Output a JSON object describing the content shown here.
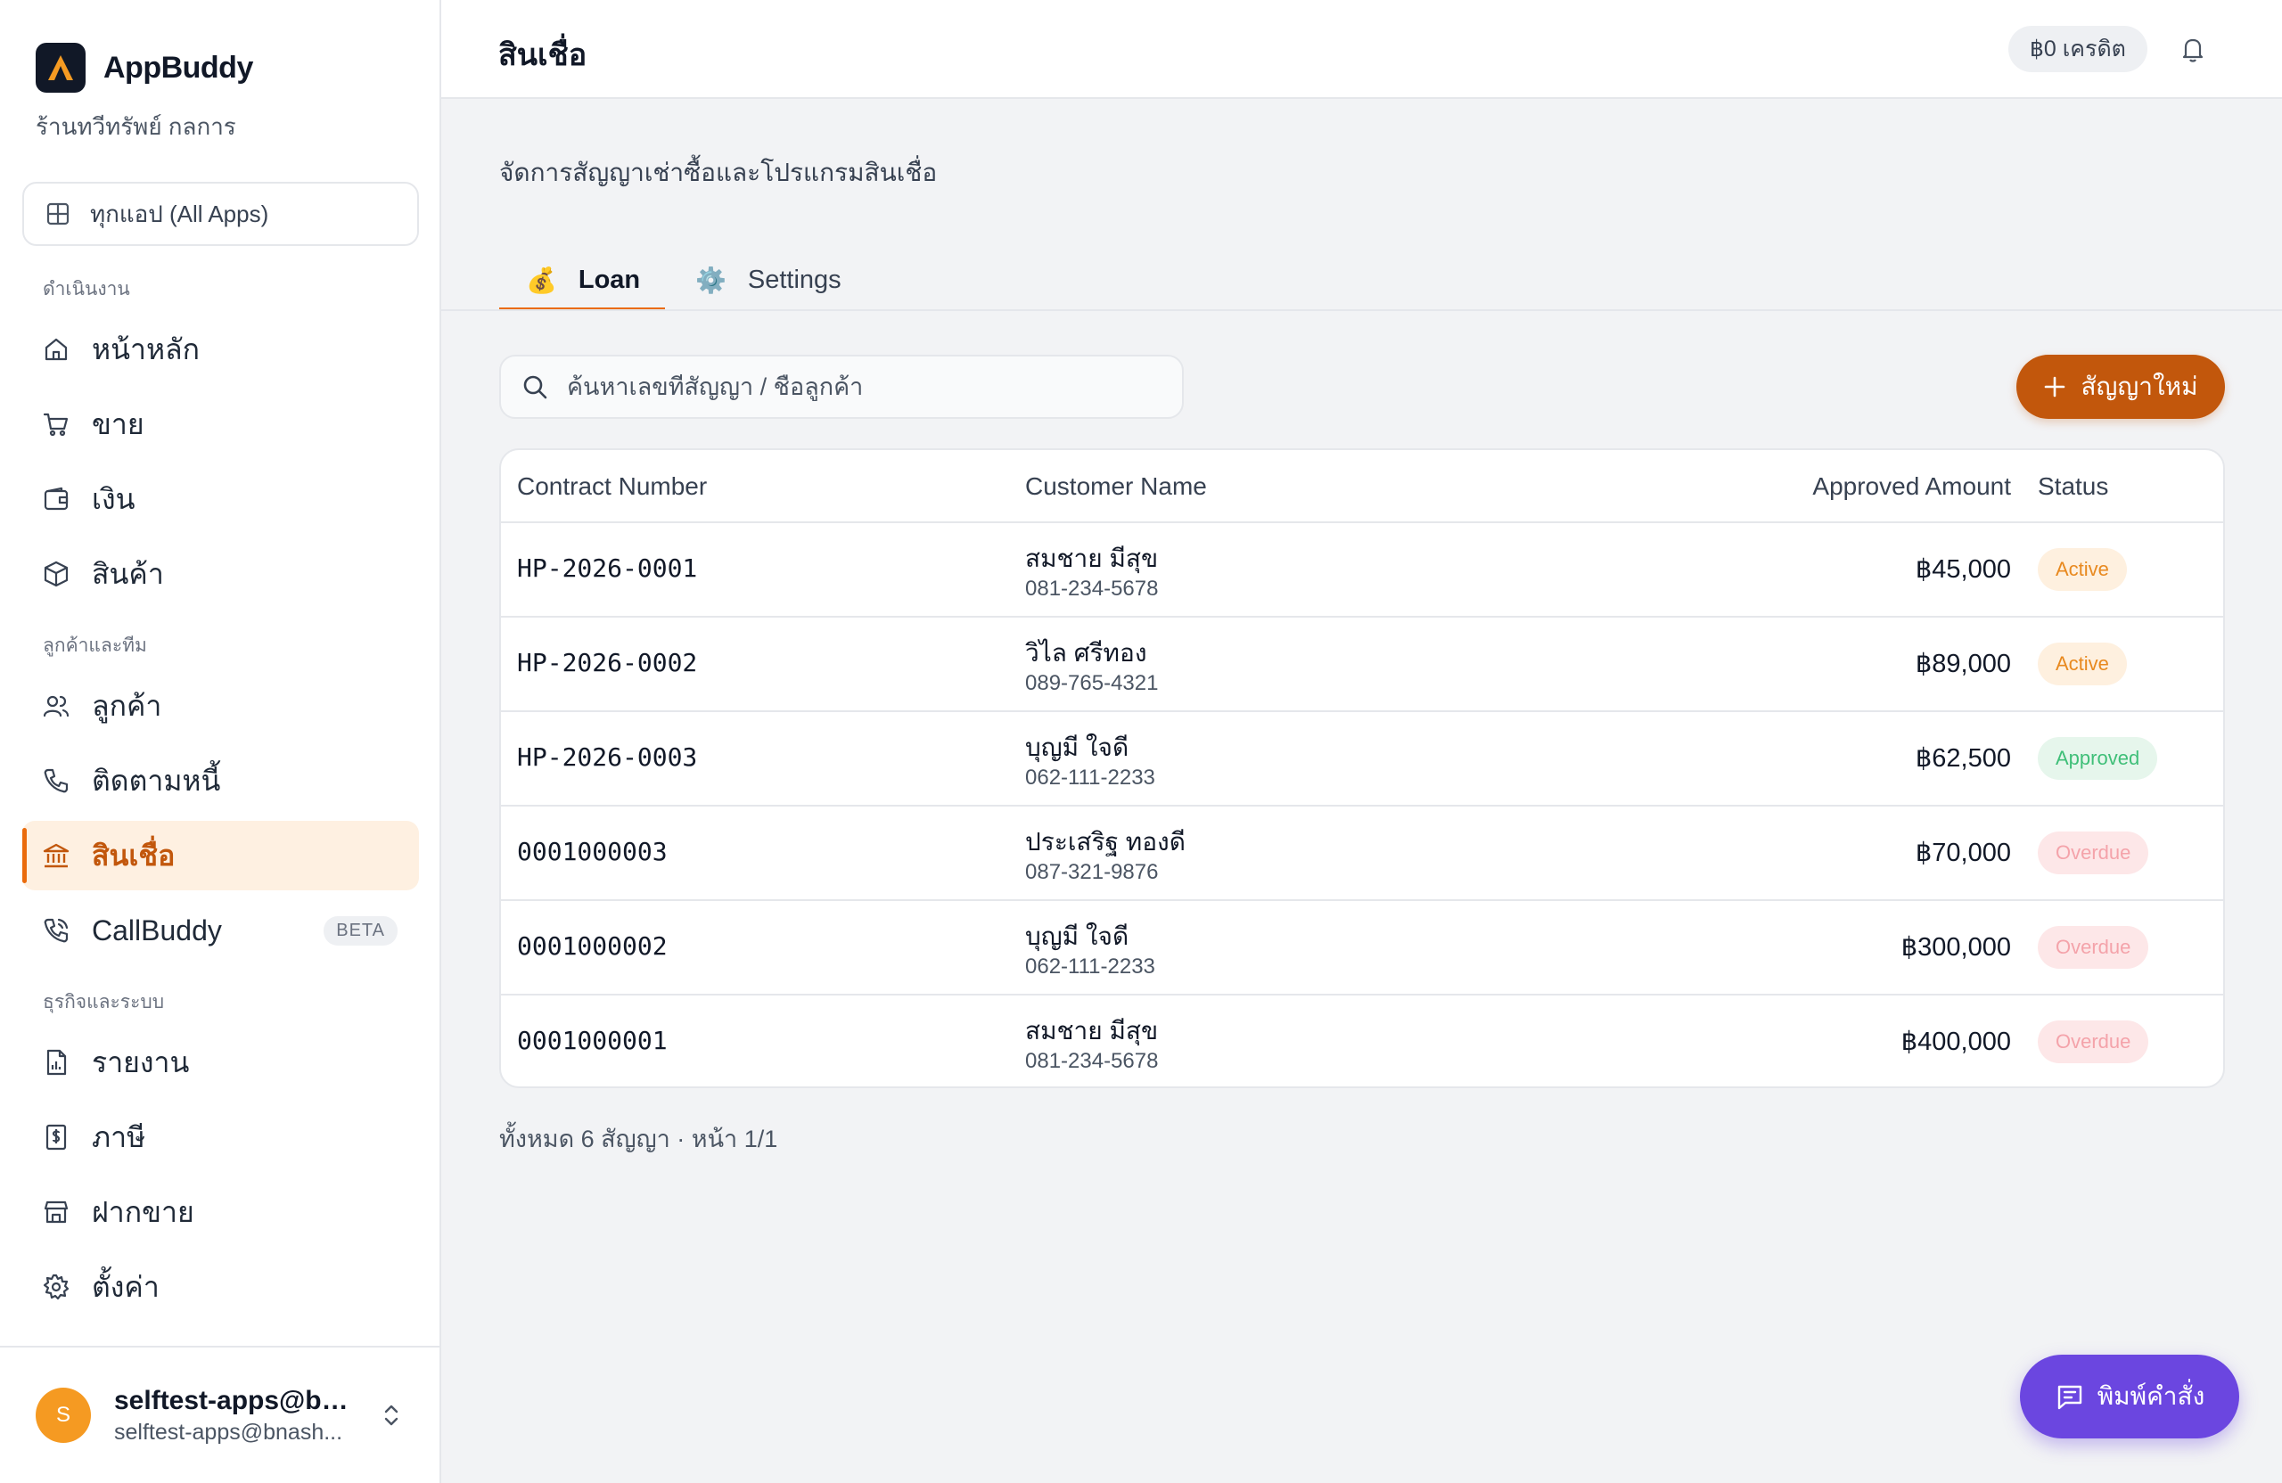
{
  "app": {
    "name": "AppBuddy",
    "shop": "ร้านทวีทรัพย์ กลการ",
    "all_apps": "ทุกแอป (All Apps)"
  },
  "sidebar": {
    "sections": {
      "operations": "ดำเนินงาน",
      "customers_team": "ลูกค้าและทีม",
      "business_system": "ธุรกิจและระบบ"
    },
    "items": {
      "home": "หน้าหลัก",
      "sell": "ขาย",
      "money": "เงิน",
      "products": "สินค้า",
      "customers": "ลูกค้า",
      "debt": "ติดตามหนี้",
      "credit": "สินเชื่อ",
      "callbuddy": "CallBuddy",
      "callbuddy_badge": "BETA",
      "reports": "รายงาน",
      "tax": "ภาษี",
      "consign": "ฝากขาย",
      "settings": "ตั้งค่า"
    },
    "active": "credit",
    "user": {
      "initial": "S",
      "name": "selftest-apps@bn...",
      "email": "selftest-apps@bnash..."
    }
  },
  "header": {
    "title": "สินเชื่อ",
    "credit": "฿0 เครดิต"
  },
  "main": {
    "subtitle": "จัดการสัญญาเช่าซื้อและโปรแกรมสินเชื่อ",
    "tabs": {
      "loan": {
        "emoji": "💰",
        "label": "Loan"
      },
      "settings": {
        "emoji": "⚙️",
        "label": "Settings"
      }
    },
    "search_placeholder": "ค้นหาเลขที่สัญญา / ชื่อลูกค้า",
    "new_contract": "สัญญาใหม่",
    "columns": {
      "contract": "Contract Number",
      "customer": "Customer Name",
      "amount": "Approved Amount",
      "status": "Status"
    },
    "rows": [
      {
        "contract": "HP-2026-0001",
        "name": "สมชาย มีสุข",
        "phone": "081-234-5678",
        "amount": "฿45,000",
        "status": "Active"
      },
      {
        "contract": "HP-2026-0002",
        "name": "วิไล ศรีทอง",
        "phone": "089-765-4321",
        "amount": "฿89,000",
        "status": "Active"
      },
      {
        "contract": "HP-2026-0003",
        "name": "บุญมี ใจดี",
        "phone": "062-111-2233",
        "amount": "฿62,500",
        "status": "Approved"
      },
      {
        "contract": "0001000003",
        "name": "ประเสริฐ ทองดี",
        "phone": "087-321-9876",
        "amount": "฿70,000",
        "status": "Overdue"
      },
      {
        "contract": "0001000002",
        "name": "บุญมี ใจดี",
        "phone": "062-111-2233",
        "amount": "฿300,000",
        "status": "Overdue"
      },
      {
        "contract": "0001000001",
        "name": "สมชาย มีสุข",
        "phone": "081-234-5678",
        "amount": "฿400,000",
        "status": "Overdue"
      }
    ],
    "summary": "ทั้งหมด 6 สัญญา · หน้า 1/1"
  },
  "command_button": "พิมพ์คำสั่ง",
  "colors": {
    "accent": "#c2570c",
    "active_bg": "#fef0e1",
    "command": "#6b46e0"
  }
}
